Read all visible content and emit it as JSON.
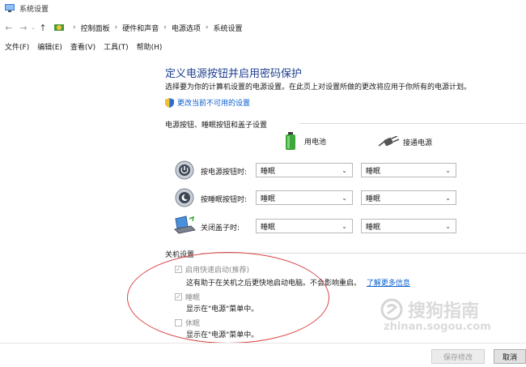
{
  "window": {
    "title": "系统设置",
    "icon": "control-panel-icon"
  },
  "nav": {
    "back_icon": "back-arrow-icon",
    "forward_icon": "forward-arrow-icon",
    "recent_icon": "chevron-down-icon",
    "up_icon": "up-arrow-icon",
    "breadcrumbs": [
      "控制面板",
      "硬件和声音",
      "电源选项",
      "系统设置"
    ]
  },
  "menu": {
    "items": [
      "文件(F)",
      "编辑(E)",
      "查看(V)",
      "工具(T)",
      "帮助(H)"
    ]
  },
  "content": {
    "heading": "定义电源按钮并启用密码保护",
    "description": "选择要为你的计算机设置的电源设置。在此页上对设置所做的更改将应用于你所有的电源计划。",
    "change_settings_link": "更改当前不可用的设置",
    "power_section_title": "电源按钮、睡眠按钮和盖子设置",
    "columns": {
      "battery": "用电池",
      "plugged": "接通电源"
    },
    "rows": [
      {
        "label": "按电源按钮时:",
        "icon": "power-button-icon",
        "battery": "睡眠",
        "plugged": "睡眠"
      },
      {
        "label": "按睡眠按钮时:",
        "icon": "sleep-button-icon",
        "battery": "睡眠",
        "plugged": "睡眠"
      },
      {
        "label": "关闭盖子时:",
        "icon": "laptop-lid-icon",
        "battery": "睡眠",
        "plugged": "睡眠"
      }
    ],
    "shutdown_section_title": "关机设置",
    "shutdown_options": [
      {
        "label": "启用快速启动(推荐)",
        "checked": true,
        "desc": "这有助于在关机之后更快地启动电脑。不会影响重启。",
        "link": "了解更多信息"
      },
      {
        "label": "睡眠",
        "checked": true,
        "desc": "显示在\"电源\"菜单中。"
      },
      {
        "label": "休眠",
        "checked": false,
        "desc": "显示在\"电源\"菜单中。"
      }
    ]
  },
  "footer": {
    "save_label": "保存修改",
    "cancel_label": "取消"
  },
  "watermark": {
    "brand": "搜狗指南",
    "url": "zhinan.sogou.com"
  },
  "colors": {
    "heading": "#1e3f8f",
    "link": "#0a5fd0",
    "annotation": "#d94545"
  }
}
